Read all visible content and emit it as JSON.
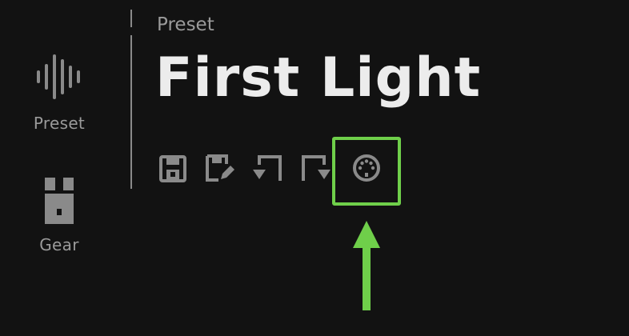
{
  "sidebar": {
    "items": [
      {
        "label": "Preset",
        "icon": "waveform-icon"
      },
      {
        "label": "Gear",
        "icon": "gear-amp-icon"
      }
    ]
  },
  "header": {
    "section_label": "Preset",
    "preset_name": "First Light"
  },
  "toolbar": {
    "buttons": [
      {
        "icon": "save-icon"
      },
      {
        "icon": "save-as-icon"
      },
      {
        "icon": "import-icon"
      },
      {
        "icon": "export-icon"
      },
      {
        "icon": "midi-icon"
      }
    ]
  },
  "annotation": {
    "highlight_color": "#6fcf4a",
    "target": "midi-icon"
  },
  "colors": {
    "background": "#121212",
    "text_primary": "#ececec",
    "text_secondary": "#9a9a9a",
    "icon": "#8a8a8a",
    "accent_green": "#6fcf4a"
  }
}
